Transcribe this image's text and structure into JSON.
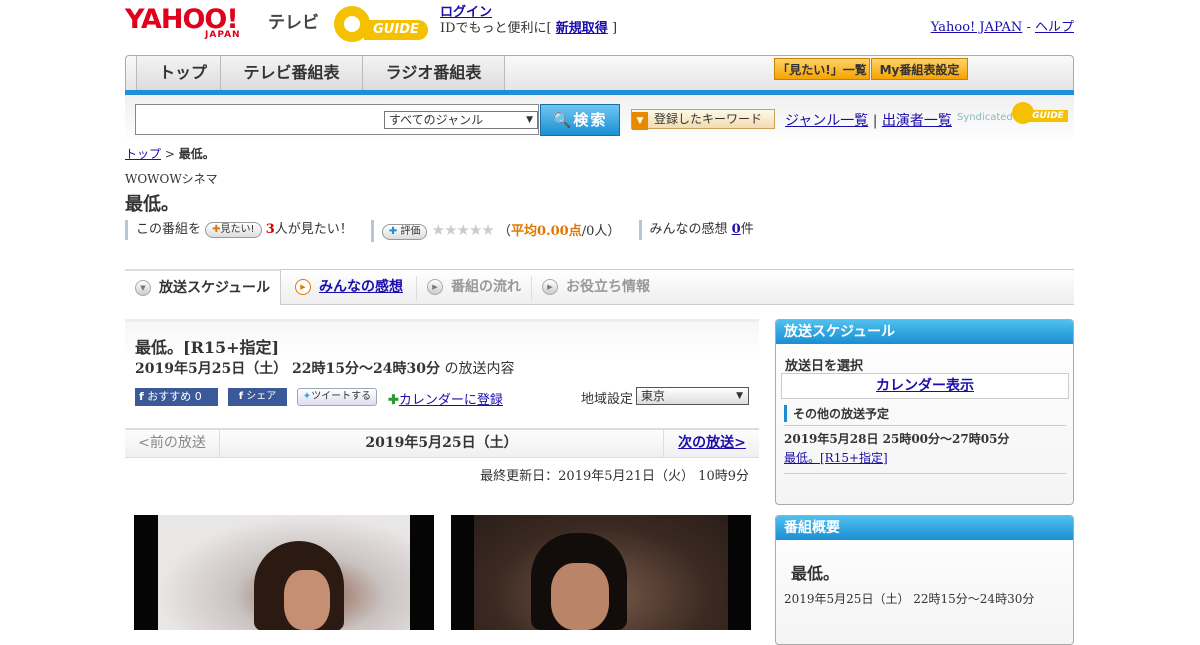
{
  "header": {
    "yahoo_logo": "YAHOO!",
    "japan_logo": "JAPAN",
    "tv_label": "テレビ",
    "gguide_logo": "GUIDE",
    "login_link": "ログイン",
    "login_prefix": "IDでもっと便利に[",
    "signup_link": "新規取得",
    "login_suffix": "]",
    "yahoo_japan_link": "Yahoo! JAPAN",
    "separator": " - ",
    "help_link": "ヘルプ"
  },
  "nav": {
    "tabs": [
      "トップ",
      "テレビ番組表",
      "ラジオ番組表"
    ],
    "mitai_list": "「見たい!」一覧",
    "my_settings": "My番組表設定"
  },
  "search": {
    "placeholder": "",
    "genre_selected": "すべてのジャンル",
    "button": "検索",
    "keyword_button": "登録したキーワード",
    "genre_list_link": "ジャンル一覧",
    "pipe": "|",
    "performer_list_link": "出演者一覧",
    "syndicated": "Syndicated",
    "syndicated_logo": "GUIDE"
  },
  "breadcrumb": {
    "top": "トップ",
    "sep": " > ",
    "current": "最低。"
  },
  "program": {
    "channel": "WOWOWシネマ",
    "title": "最低。",
    "mitai_prefix": "この番組を",
    "mitai_button": "見たい!",
    "mitai_count": "3",
    "mitai_suffix": "人が見たい！",
    "rating_button": "評価",
    "stars": "★★★★★",
    "rating_open": "（",
    "rating_avg": "平均0.00点",
    "rating_count": "/0人）",
    "impressions_label": "みんなの感想",
    "impressions_count": "0",
    "impressions_unit": "件"
  },
  "subtabs": {
    "schedule": "放送スケジュール",
    "impressions": "みんなの感想",
    "flow": "番組の流れ",
    "info": "お役立ち情報"
  },
  "episode": {
    "title": "最低。[R15+指定]",
    "datetime": "2019年5月25日（土） 22時15分～24時30分",
    "datetime_suffix": " の放送内容",
    "fb_recommend": "おすすめ 0",
    "fb_share": "シェア",
    "tweet": "ツイートする",
    "calendar_register": "カレンダーに登録",
    "region_label": "地域設定",
    "region_selected": "東京"
  },
  "pager": {
    "prev": "<前の放送",
    "date": "2019年5月25日（土）",
    "next": "次の放送>"
  },
  "last_updated": "最終更新日：2019年5月21日（火） 10時9分",
  "sidebar": {
    "schedule_head": "放送スケジュール",
    "select_date": "放送日を選択",
    "calendar_button": "カレンダー表示",
    "other_head": "その他の放送予定",
    "other_time": "2019年5月28日 25時00分～27時05分",
    "other_link": "最低。[R15+指定]",
    "summary_head": "番組概要",
    "summary_title": "最低。",
    "summary_time": "2019年5月25日（土） 22時15分～24時30分"
  }
}
